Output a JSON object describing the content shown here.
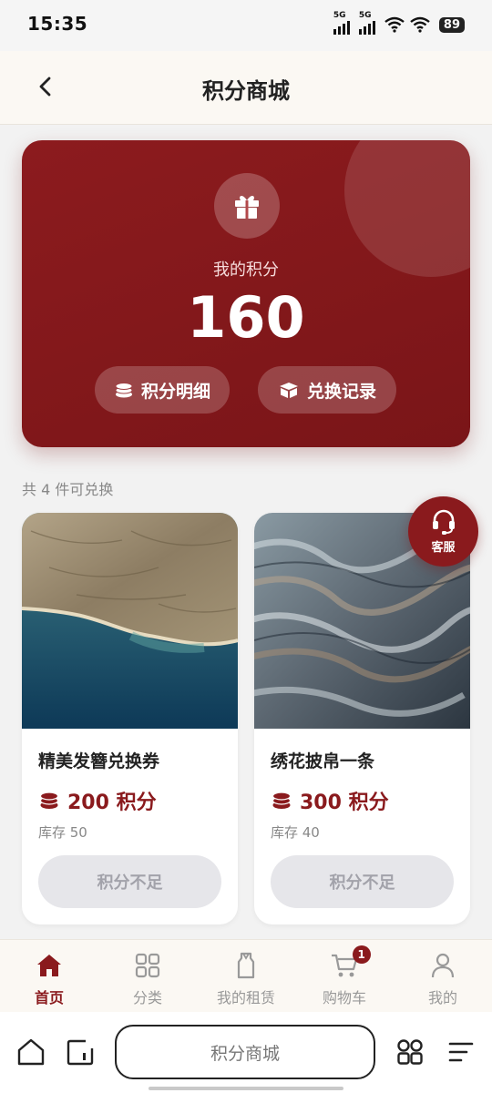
{
  "status_bar": {
    "time": "15:35",
    "net1": "5G",
    "net2": "5G",
    "battery": "89"
  },
  "header": {
    "title": "积分商城"
  },
  "points_card": {
    "label": "我的积分",
    "value": "160",
    "detail_button": "积分明细",
    "history_button": "兑换记录"
  },
  "count_text": "共 4 件可兑换",
  "products": [
    {
      "name": "精美发簪兑换券",
      "price": "200 积分",
      "stock": "库存 50",
      "button": "积分不足"
    },
    {
      "name": "绣花披帛一条",
      "price": "300 积分",
      "stock": "库存 40",
      "button": "积分不足"
    }
  ],
  "service": {
    "label": "客服"
  },
  "tabbar": {
    "items": [
      {
        "label": "首页",
        "icon": "home-icon",
        "active": true
      },
      {
        "label": "分类",
        "icon": "grid-icon"
      },
      {
        "label": "我的租赁",
        "icon": "garment-icon"
      },
      {
        "label": "购物车",
        "icon": "cart-icon",
        "badge": "1"
      },
      {
        "label": "我的",
        "icon": "person-icon"
      }
    ]
  },
  "browser": {
    "address": "积分商城"
  },
  "colors": {
    "accent": "#8a1a1d",
    "card_bg": "#7f1719",
    "disabled_btn": "#e6e6ea"
  }
}
